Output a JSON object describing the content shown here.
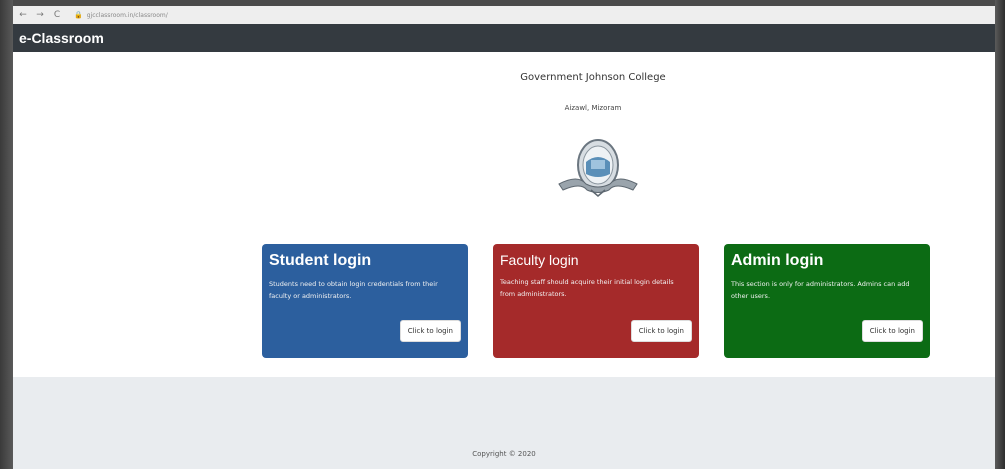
{
  "browser": {
    "back_icon": "←",
    "forward_icon": "→",
    "reload_icon": "C",
    "url": "gjcclassroom.in/classroom/"
  },
  "navbar": {
    "brand": "e-Classroom"
  },
  "header": {
    "college_name": "Government Johnson College",
    "location": "Aizawl, Mizoram",
    "emblem_icon": "college-emblem"
  },
  "cards": [
    {
      "title": "Student login",
      "text": "Students need to obtain login credentials from their faculty or administrators.",
      "button": "Click to login",
      "color": "#2c5f9e"
    },
    {
      "title": "Faculty login",
      "text": "Teaching staff should acquire their initial login details from administrators.",
      "button": "Click to login",
      "color": "#a52a2a"
    },
    {
      "title": "Admin login",
      "text": "This section is only for administrators. Admins can add other users.",
      "button": "Click to login",
      "color": "#0c6b14"
    }
  ],
  "footer": {
    "copyright": "Copyright © 2020"
  }
}
